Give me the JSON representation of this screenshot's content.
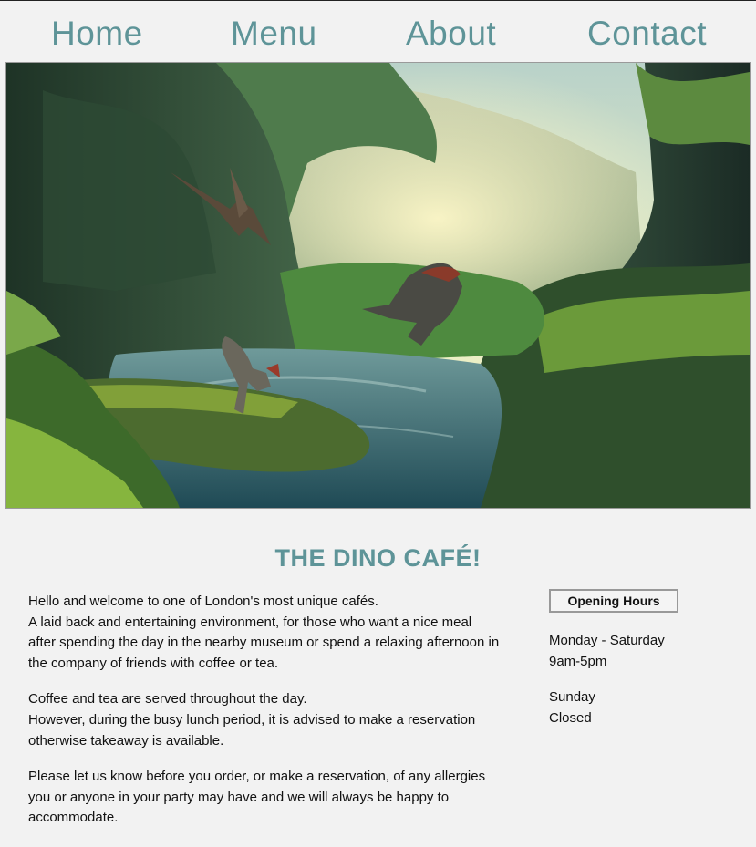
{
  "nav": {
    "items": [
      "Home",
      "Menu",
      "About",
      "Contact"
    ]
  },
  "hero": {
    "image_description": "fantasy landscape with dinosaurs in a lush jungle canyon with a river"
  },
  "page": {
    "title": "THE DINO CAFÉ!"
  },
  "intro": {
    "p1_line1": "Hello and welcome to one of London's most unique cafés.",
    "p1_line2": "A laid back and entertaining environment, for those who want a nice meal after spending the day in the nearby museum or spend a relaxing afternoon in the company of friends with coffee or tea.",
    "p2_line1": "Coffee and tea are served throughout the day.",
    "p2_line2": "However, during the busy lunch period, it is advised to make a reservation otherwise takeaway is available.",
    "p3": "Please let us know before you order, or make a reservation, of any allergies you or anyone in your party may have and we will always be happy to accommodate."
  },
  "hours": {
    "title": "Opening Hours",
    "weekday_days": "Monday - Saturday",
    "weekday_time": "9am-5pm",
    "sunday_days": "Sunday",
    "sunday_time": "Closed"
  },
  "colors": {
    "accent": "#5e9498",
    "background": "#f2f2f2"
  }
}
